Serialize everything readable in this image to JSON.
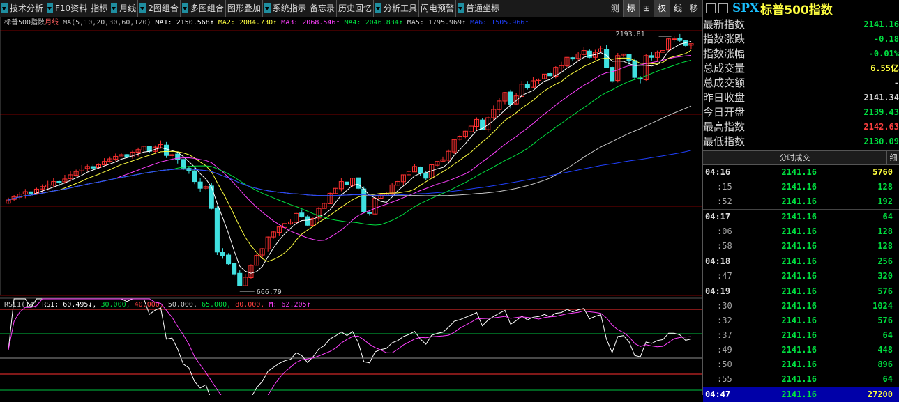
{
  "toolbar": {
    "items": [
      {
        "label": "技术分析",
        "arrow": true
      },
      {
        "label": "F10资料",
        "arrow": true
      },
      {
        "label": "指标",
        "arrow": false
      },
      {
        "label": "月线",
        "arrow": true
      },
      {
        "label": "2图组合",
        "arrow": true
      },
      {
        "label": "多图组合",
        "arrow": true
      },
      {
        "label": "图形叠加",
        "arrow": false
      },
      {
        "label": "系统指示",
        "arrow": true
      },
      {
        "label": "备忘录",
        "arrow": false
      },
      {
        "label": "历史回忆",
        "arrow": false
      },
      {
        "label": "分析工具",
        "arrow": true
      },
      {
        "label": "闪电预警",
        "arrow": false
      },
      {
        "label": "普通坐标",
        "arrow": true
      }
    ],
    "right_buttons": [
      "测",
      "标",
      "⊞",
      "权",
      "线",
      "移"
    ]
  },
  "main_header": {
    "name": "标普500指数",
    "period": "月线",
    "ma_params": "MA(5,10,20,30,60,120)",
    "ma1": "MA1: 2150.568↑",
    "ma2": "MA2: 2084.730↑",
    "ma3": "MA3: 2068.546↑",
    "ma4": "MA4: 2046.834↑",
    "ma5": "MA5: 1795.969↑",
    "ma6": "MA6: 1505.966↑"
  },
  "annotations": {
    "high": "2193.81",
    "low": "666.79"
  },
  "rsi_header": {
    "name": "RSI1(14)",
    "rsi": "RSI: 60.495↓",
    "l30": "30.000",
    "l40": "40.000",
    "l50": "50.000",
    "l65": "65.000",
    "l80": "80.000",
    "m": "M: 62.205↑"
  },
  "colors": {
    "up": "#ff3030",
    "down": "#40e0e0",
    "ma1": "#ffffff",
    "ma2": "#ffff40",
    "ma3": "#ff40ff",
    "ma4": "#00e040",
    "ma5": "#c8c8c8",
    "ma6": "#2040ff",
    "grid": "#7a0000",
    "bg": "#000000"
  },
  "chart_data": {
    "type": "candlestick",
    "title": "标普500指数 月线",
    "ohlc_note": "approximate monthly closes read from chart",
    "closes": [
      1210,
      1230,
      1245,
      1260,
      1250,
      1275,
      1290,
      1300,
      1320,
      1315,
      1335,
      1360,
      1380,
      1395,
      1410,
      1400,
      1420,
      1440,
      1455,
      1470,
      1480,
      1465,
      1495,
      1510,
      1530,
      1500,
      1525,
      1540,
      1475,
      1480,
      1450,
      1400,
      1385,
      1320,
      1280,
      1290,
      1160,
      900,
      880,
      830,
      770,
      700,
      750,
      820,
      880,
      920,
      990,
      1020,
      1050,
      1070,
      1080,
      1130,
      1110,
      1060,
      1100,
      1160,
      1190,
      1250,
      1280,
      1320,
      1300,
      1340,
      1280,
      1140,
      1130,
      1220,
      1240,
      1250,
      1300,
      1320,
      1360,
      1380,
      1410,
      1370,
      1340,
      1420,
      1440,
      1450,
      1500,
      1570,
      1590,
      1620,
      1650,
      1690,
      1630,
      1700,
      1750,
      1800,
      1850,
      1780,
      1830,
      1900,
      1880,
      1920,
      1930,
      1960,
      1950,
      2000,
      2010,
      2060,
      2050,
      2080,
      2100,
      2060,
      2090,
      2110,
      2000,
      1920,
      2070,
      2080,
      2040,
      1940,
      1930,
      2070,
      2060,
      2090,
      2100,
      2170,
      2170,
      2160,
      2130,
      2141
    ],
    "range": [
      666.79,
      2193.81
    ],
    "rsi_lines": [
      30,
      40,
      50,
      65,
      80
    ]
  },
  "quote": {
    "code": "SPX",
    "name": "标普500指数",
    "rows": [
      {
        "label": "最新指数",
        "value": "2141.16",
        "color": "#00e040"
      },
      {
        "label": "指数涨跌",
        "value": "-0.18",
        "color": "#00e040"
      },
      {
        "label": "指数涨幅",
        "value": "-0.01%",
        "color": "#00e040"
      },
      {
        "label": "总成交量",
        "value": "6.55亿",
        "color": "#ffff40"
      },
      {
        "label": "总成交额",
        "value": "-",
        "color": "#d8d8d8"
      },
      {
        "label": "昨日收盘",
        "value": "2141.34",
        "color": "#d8d8d8"
      },
      {
        "label": "今日开盘",
        "value": "2139.43",
        "color": "#00e040"
      },
      {
        "label": "最高指数",
        "value": "2142.63",
        "color": "#ff4040"
      },
      {
        "label": "最低指数",
        "value": "2130.09",
        "color": "#00e040"
      }
    ]
  },
  "ticks": {
    "title": "分时成交",
    "detail": "细",
    "rows": [
      {
        "time": "04:16",
        "price": "2141.16",
        "vol": "5760",
        "vcolor": "#ffff40",
        "sub": false
      },
      {
        "time": ":15",
        "price": "2141.16",
        "vol": "128",
        "vcolor": "#00e040",
        "sub": true
      },
      {
        "time": ":52",
        "price": "2141.16",
        "vol": "192",
        "vcolor": "#00e040",
        "sub": true
      },
      {
        "time": "04:17",
        "price": "2141.16",
        "vol": "64",
        "vcolor": "#00e040",
        "sub": false
      },
      {
        "time": ":06",
        "price": "2141.16",
        "vol": "128",
        "vcolor": "#00e040",
        "sub": true
      },
      {
        "time": ":58",
        "price": "2141.16",
        "vol": "128",
        "vcolor": "#00e040",
        "sub": true
      },
      {
        "time": "04:18",
        "price": "2141.16",
        "vol": "256",
        "vcolor": "#00e040",
        "sub": false
      },
      {
        "time": ":47",
        "price": "2141.16",
        "vol": "320",
        "vcolor": "#00e040",
        "sub": true
      },
      {
        "time": "04:19",
        "price": "2141.16",
        "vol": "576",
        "vcolor": "#00e040",
        "sub": false
      },
      {
        "time": ":30",
        "price": "2141.16",
        "vol": "1024",
        "vcolor": "#00e040",
        "sub": true
      },
      {
        "time": ":32",
        "price": "2141.16",
        "vol": "576",
        "vcolor": "#00e040",
        "sub": true
      },
      {
        "time": ":37",
        "price": "2141.16",
        "vol": "64",
        "vcolor": "#00e040",
        "sub": true
      },
      {
        "time": ":49",
        "price": "2141.16",
        "vol": "448",
        "vcolor": "#00e040",
        "sub": true
      },
      {
        "time": ":50",
        "price": "2141.16",
        "vol": "896",
        "vcolor": "#00e040",
        "sub": true
      },
      {
        "time": ":55",
        "price": "2141.16",
        "vol": "64",
        "vcolor": "#00e040",
        "sub": true
      },
      {
        "time": "04:47",
        "price": "2141.16",
        "vol": "27200",
        "vcolor": "#ffff40",
        "sub": false,
        "last": true
      }
    ]
  }
}
